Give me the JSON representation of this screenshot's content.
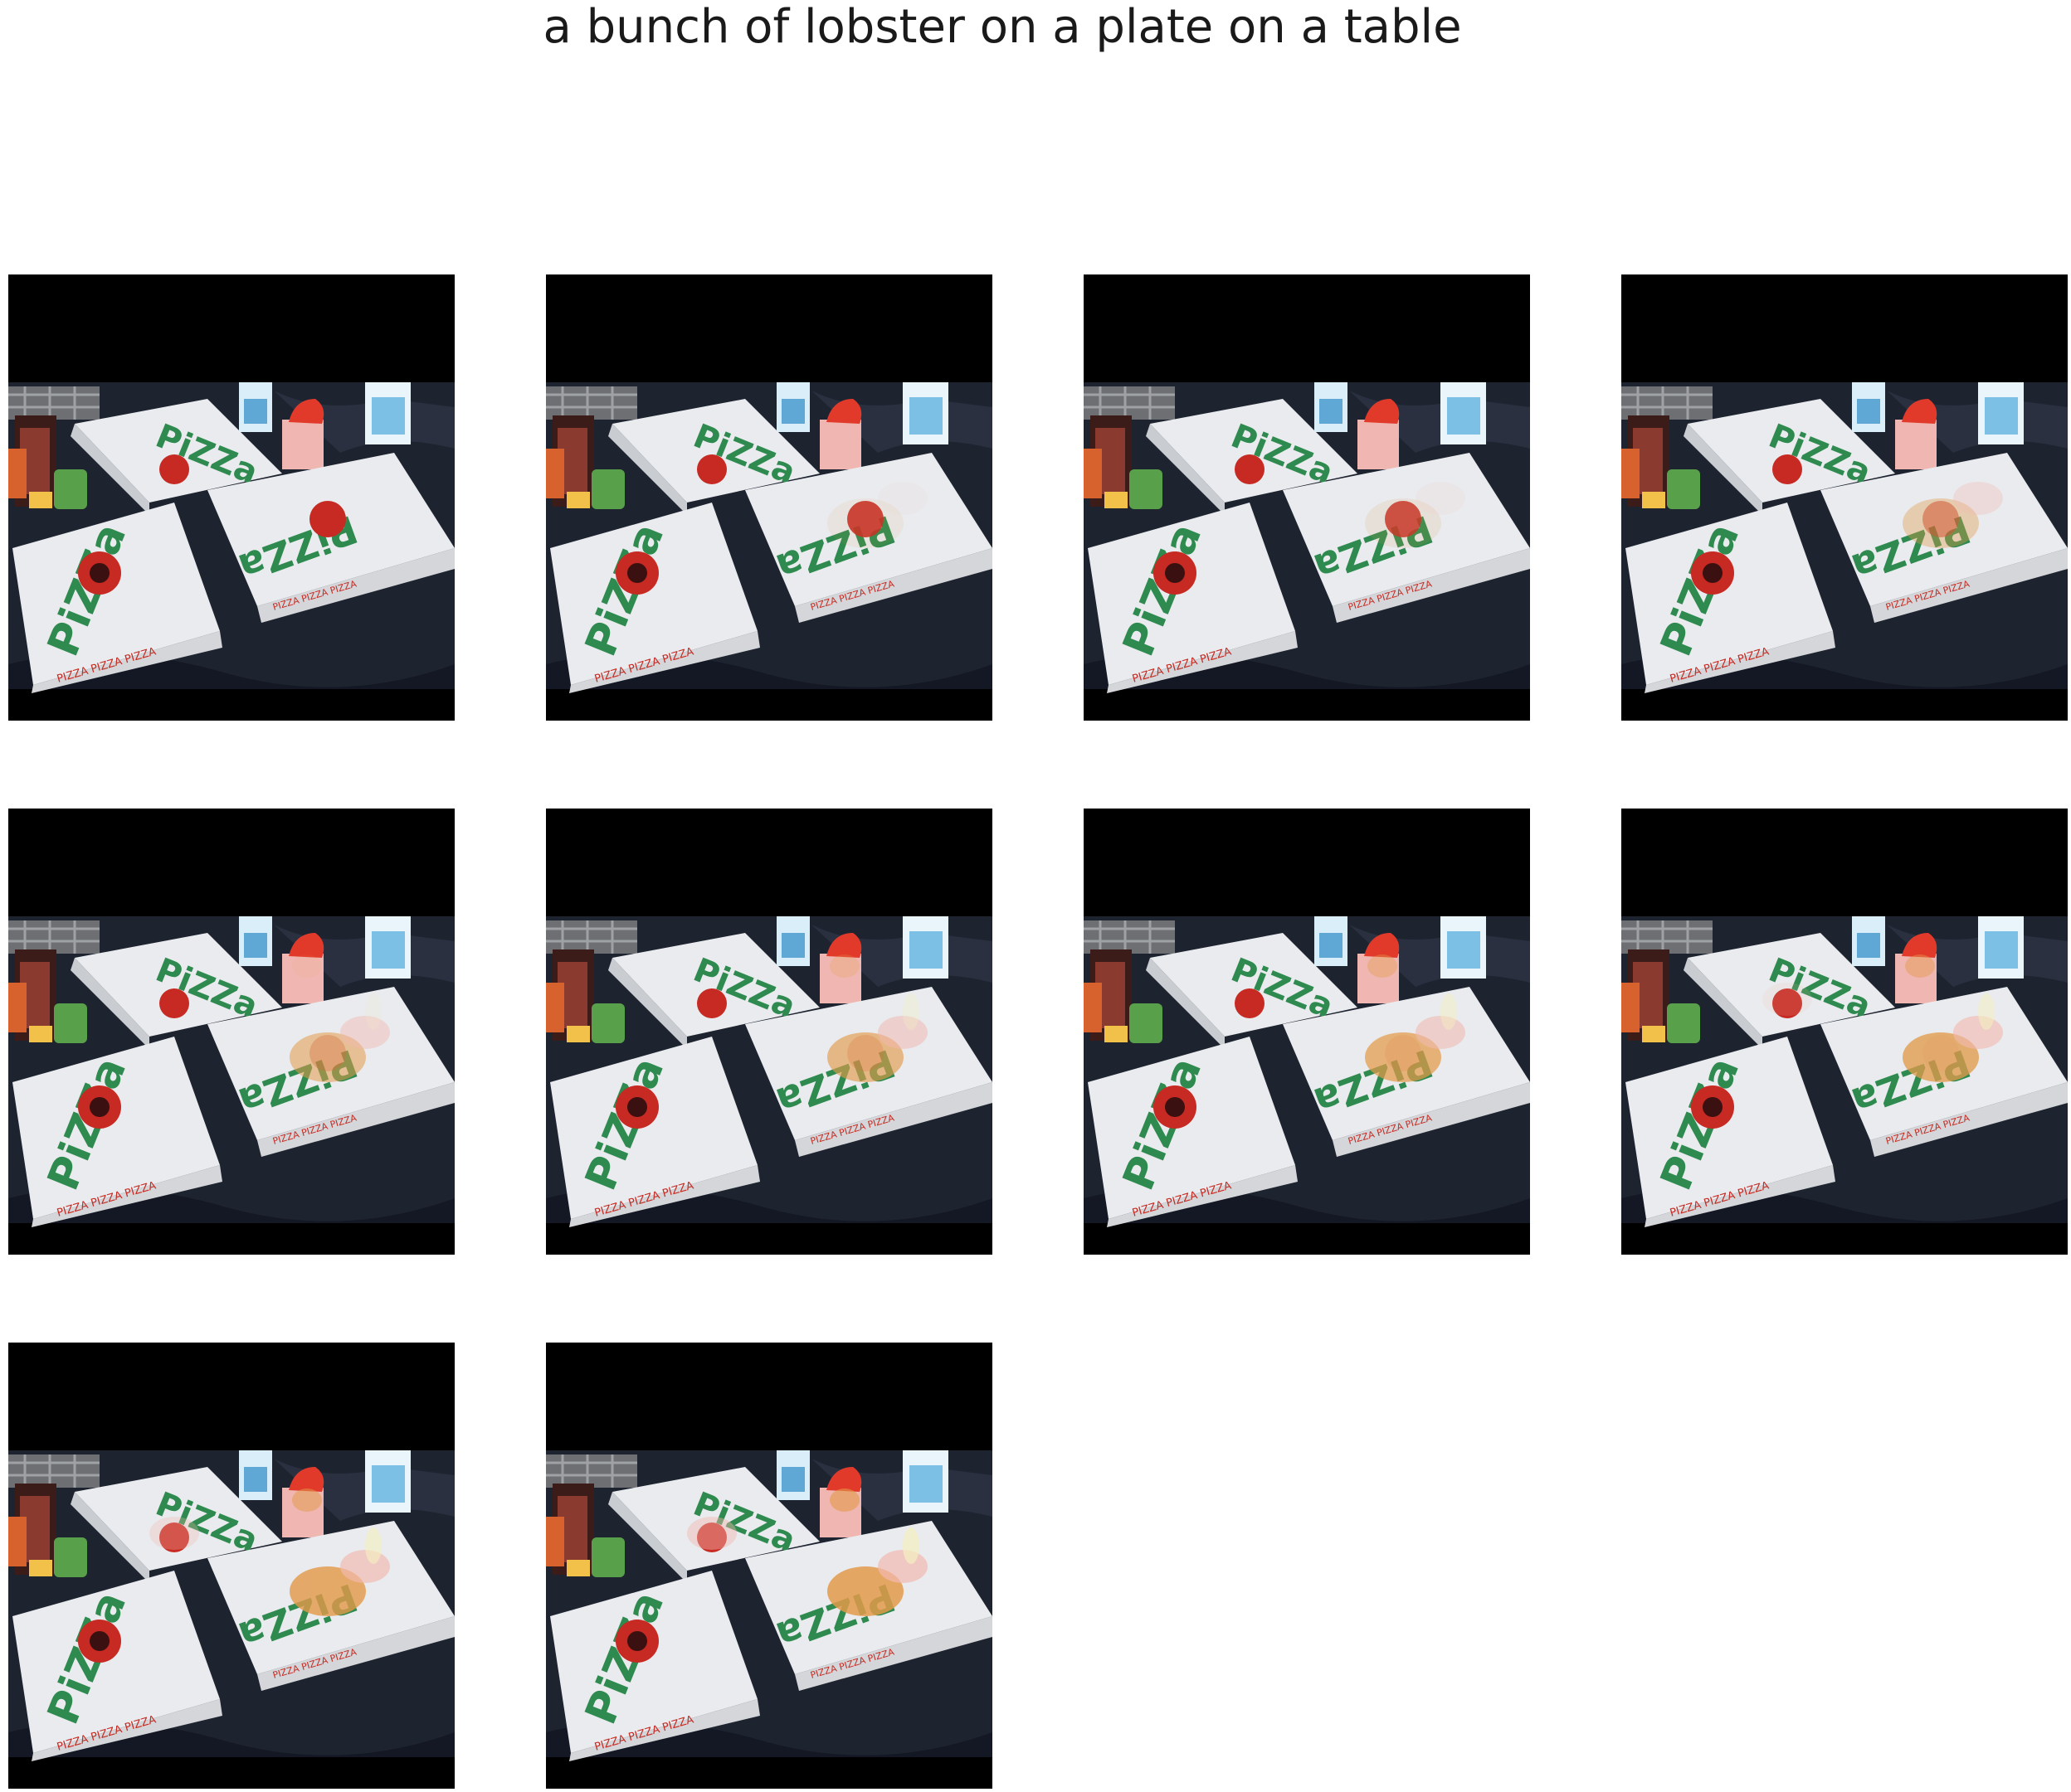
{
  "figure": {
    "title": "a bunch of lobster on a plate on a table"
  },
  "frames": [
    {
      "step": 1,
      "overlay_strength": 0.0
    },
    {
      "step": 2,
      "overlay_strength": 0.1
    },
    {
      "step": 3,
      "overlay_strength": 0.15
    },
    {
      "step": 4,
      "overlay_strength": 0.45
    },
    {
      "step": 5,
      "overlay_strength": 0.65
    },
    {
      "step": 6,
      "overlay_strength": 0.75
    },
    {
      "step": 7,
      "overlay_strength": 0.85
    },
    {
      "step": 8,
      "overlay_strength": 0.9
    },
    {
      "step": 9,
      "overlay_strength": 0.95
    },
    {
      "step": 10,
      "overlay_strength": 1.0
    }
  ],
  "colors": {
    "background": "#ffffff",
    "letterbox": "#000000",
    "tablecloth": "#1e2330",
    "box_white": "#e9ebee",
    "logo_green": "#2e8a4e",
    "logo_red": "#c62a22",
    "lobster_orange": "#e39a4a",
    "lobster_pink": "#f2b9b0"
  }
}
